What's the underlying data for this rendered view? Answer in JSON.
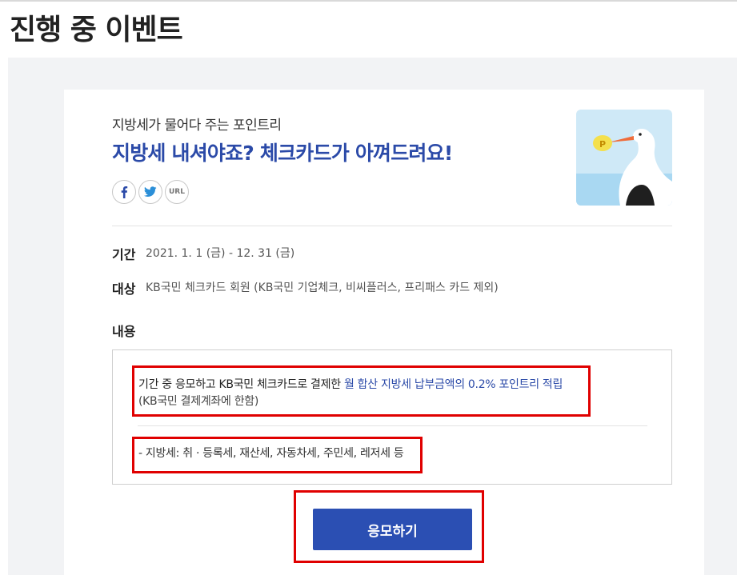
{
  "page": {
    "title": "진행 중 이벤트"
  },
  "event": {
    "subtitle": "지방세가 물어다 주는 포인트리",
    "headline": "지방세 내셔야죠? 체크카드가 아껴드려요!",
    "share": {
      "facebook_icon": "facebook-icon",
      "twitter_icon": "twitter-icon",
      "url_label": "URL"
    },
    "thumbnail_icon": "stork-with-coin-illustration",
    "period": {
      "label": "기간",
      "value": "2021. 1. 1 (금) - 12. 31 (금)"
    },
    "target": {
      "label": "대상",
      "value": "KB국민 체크카드 회원 (KB국민 기업체크, 비씨플러스, 프리패스 카드 제외)"
    },
    "content": {
      "label": "내용",
      "line1_plain": "기간 중 응모하고 KB국민 체크카드로 결제한 ",
      "line1_emph": "월 합산 지방세 납부금액의 0.2% 포인트리 적립",
      "line2": "(KB국민 결제계좌에 한함)",
      "line3": "- 지방세: 취 · 등록세, 재산세, 자동차세, 주민세, 레저세 등"
    },
    "apply_button": "응모하기"
  },
  "colors": {
    "accent_blue": "#2b4aa8",
    "button_blue": "#2b4fb3",
    "highlight_red": "#e00000",
    "gray_background": "#f2f3f5"
  }
}
